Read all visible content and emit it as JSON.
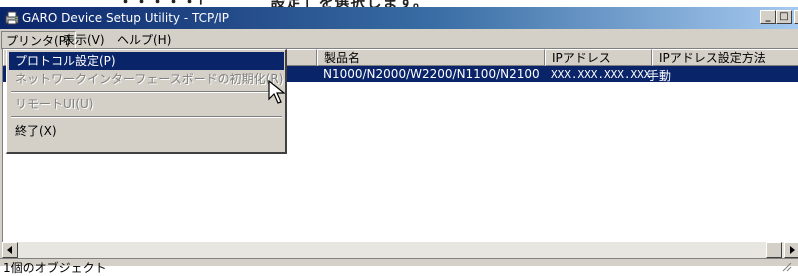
{
  "window": {
    "title": "GARO Device Setup Utility - TCP/IP",
    "controls": {
      "minimize": "_",
      "maximize": "□",
      "close": "×"
    }
  },
  "menubar": {
    "items": [
      {
        "label": "プリンタ(P)"
      },
      {
        "label": "表示(V)"
      },
      {
        "label": "ヘルプ(H)"
      }
    ]
  },
  "printer_menu": {
    "items": [
      {
        "label": "プロトコル設定(P)",
        "state": "highlighted"
      },
      {
        "label": "ネットワークインターフェースボードの初期化(R)",
        "state": "disabled"
      },
      {
        "label": "リモートUI(U)",
        "state": "disabled"
      },
      {
        "label": "終了(X)",
        "state": "enabled"
      }
    ]
  },
  "table": {
    "columns": [
      "製品名",
      "IPアドレス",
      "IPアドレス設定方法"
    ],
    "rows": [
      {
        "product": "N1000/N2000/W2200/N1100/N2100",
        "ip": "XXX.XXX.XXX.XXX",
        "method": "手動"
      }
    ]
  },
  "statusbar": {
    "text": "1個のオブジェクト"
  },
  "icons": [
    "printer-app-icon",
    "mouse-pointer-icon",
    "scroll-left-icon",
    "scroll-right-icon",
    "size-grip-icon"
  ],
  "colors": {
    "titlebar_start": "#0a246a",
    "titlebar_end": "#a6caf0",
    "selection": "#0a246a",
    "face": "#d4d0c8"
  }
}
